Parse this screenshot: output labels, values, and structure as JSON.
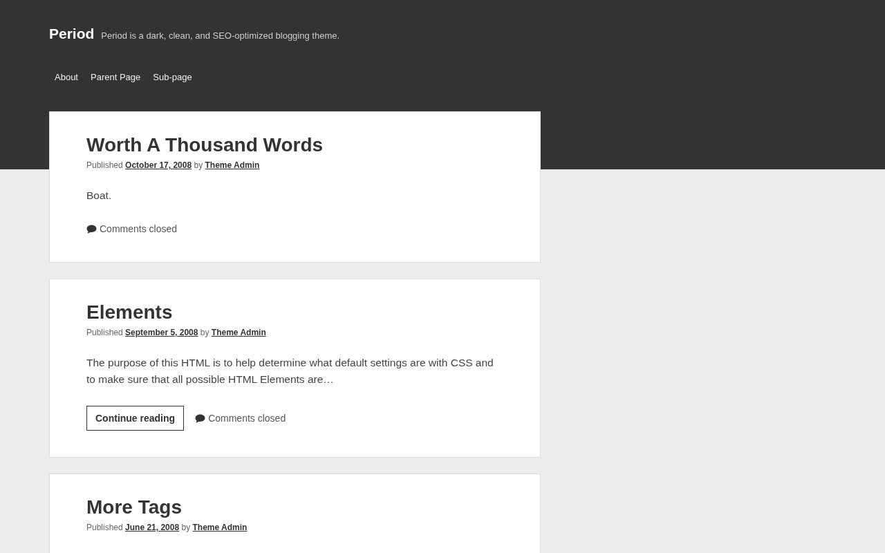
{
  "site": {
    "title": "Period",
    "tagline": "Period is a dark, clean, and SEO-optimized blogging theme."
  },
  "nav": [
    {
      "label": "About"
    },
    {
      "label": "Parent Page"
    },
    {
      "label": "Sub-page"
    }
  ],
  "posts": [
    {
      "title": "Worth A Thousand Words",
      "meta": {
        "prefix": "Published",
        "date": "October 17, 2008",
        "joiner": "by",
        "author": "Theme Admin"
      },
      "excerpt": "Boat.",
      "comments": "Comments closed"
    },
    {
      "title": "Elements",
      "meta": {
        "prefix": "Published",
        "date": "September 5, 2008",
        "joiner": "by",
        "author": "Theme Admin"
      },
      "excerpt": "The purpose of this HTML is to help determine what default settings are with CSS and to make sure that all possible HTML Elements are…",
      "more_link": "Continue reading",
      "comments": "Comments closed"
    },
    {
      "title": "More Tags",
      "meta": {
        "prefix": "Published",
        "date": "June 21, 2008",
        "joiner": "by",
        "author": "Theme Admin"
      }
    }
  ]
}
